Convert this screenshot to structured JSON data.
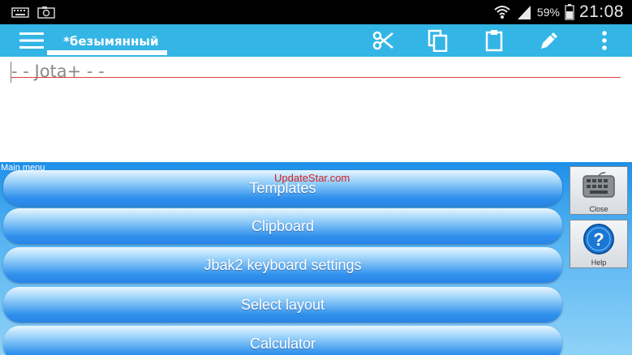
{
  "status_bar": {
    "battery": "59%",
    "time": "21:08",
    "icons": [
      "keyboard-icon",
      "screenshot-icon",
      "wifi-icon",
      "signal-icon",
      "battery-icon"
    ]
  },
  "app_bar": {
    "tab_title": "*безымянный",
    "actions": [
      "cut-icon",
      "copy-icon",
      "paste-icon",
      "edit-icon",
      "overflow-icon"
    ],
    "accent": "#33b5e5"
  },
  "editor": {
    "text": "- - Jota+ - -"
  },
  "menu_panel": {
    "title": "Main menu",
    "watermark": "UpdateStar.com",
    "items": [
      {
        "label": "Templates"
      },
      {
        "label": "Clipboard"
      },
      {
        "label": "Jbak2 keyboard settings"
      },
      {
        "label": "Select layout"
      },
      {
        "label": "Calculator"
      }
    ],
    "side_buttons": {
      "close": "Close",
      "help": "Help"
    }
  }
}
